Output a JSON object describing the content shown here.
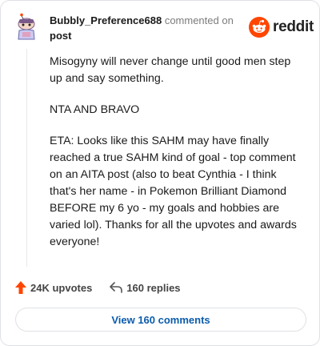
{
  "header": {
    "username": "Bubbly_Preference688",
    "commented_text": "commented on",
    "post_link": "post",
    "logo_text": "reddit",
    "logo_icon": "reddit-alien-icon",
    "avatar_icon": "snoo-avatar"
  },
  "comment": {
    "paragraphs": [
      "Misogyny will never change until good men step up and say something.",
      "NTA AND BRAVO",
      "ETA: Looks like this SAHM may have finally reached a true SAHM kind of goal - top comment on an AITA post (also to beat Cynthia - I think that's her name - in Pokemon Brilliant Diamond BEFORE my 6 yo - my goals and hobbies are varied lol). Thanks for all the upvotes and awards everyone!"
    ]
  },
  "actions": {
    "upvotes": "24K upvotes",
    "replies": "160 replies"
  },
  "footer": {
    "view_button": "View 160 comments"
  },
  "colors": {
    "brand": "#ff4500",
    "link": "#0b5cab",
    "muted": "#7c7c7c"
  }
}
